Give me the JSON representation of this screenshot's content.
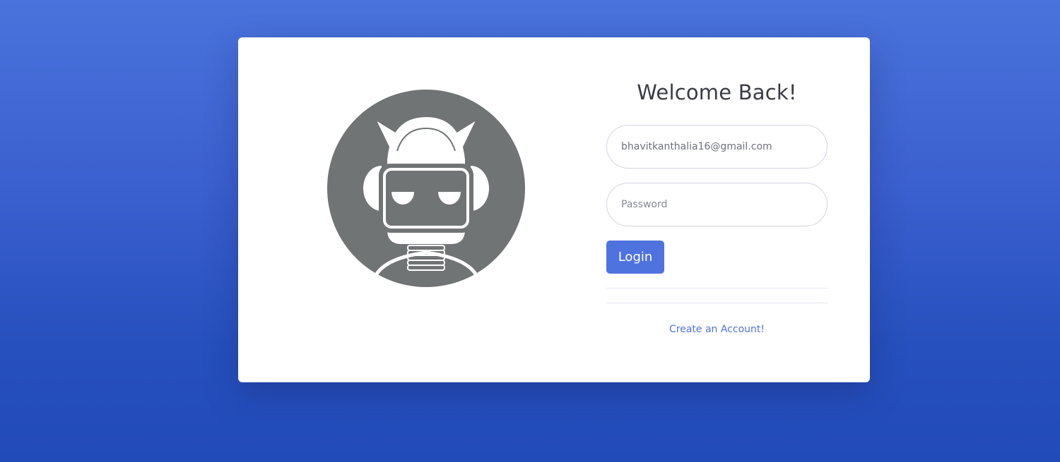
{
  "login": {
    "title": "Welcome Back!",
    "email_value": "bhavitkanthalia16@gmail.com",
    "password_placeholder": "Password",
    "login_label": "Login",
    "create_account_label": "Create an Account!"
  },
  "logo": {
    "icon": "robot-icon",
    "circle_color": "#717474"
  },
  "colors": {
    "accent": "#4e73df",
    "card": "#ffffff",
    "background_top": "#4a73dc",
    "background_bottom": "#224bba"
  }
}
